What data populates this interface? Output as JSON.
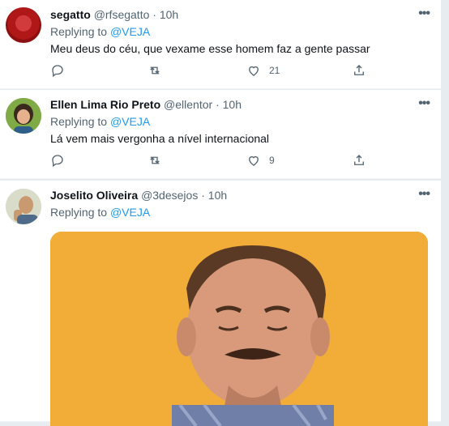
{
  "tweets": [
    {
      "name": "segatto",
      "handle": "@rfsegatto",
      "time": "10h",
      "replying_prefix": "Replying to",
      "replying_to": "@VEJA",
      "text": "Meu deus do céu, que vexame esse homem faz a gente passar",
      "likes": "21"
    },
    {
      "name": "Ellen Lima Rio Preto",
      "handle": "@ellentor",
      "time": "10h",
      "replying_prefix": "Replying to",
      "replying_to": "@VEJA",
      "text": "Lá vem mais vergonha a nível internacional",
      "likes": "9"
    },
    {
      "name": "Joselito Oliveira",
      "handle": "@3desejos",
      "time": "10h",
      "replying_prefix": "Replying to",
      "replying_to": "@VEJA"
    }
  ],
  "icons": {
    "more": "more-icon",
    "reply": "reply-icon",
    "retweet": "retweet-icon",
    "like": "heart-icon",
    "share": "share-icon"
  },
  "colors": {
    "accent": "#1d9bf0",
    "secondary_text": "#536471",
    "media_background": "#f2ac38"
  }
}
